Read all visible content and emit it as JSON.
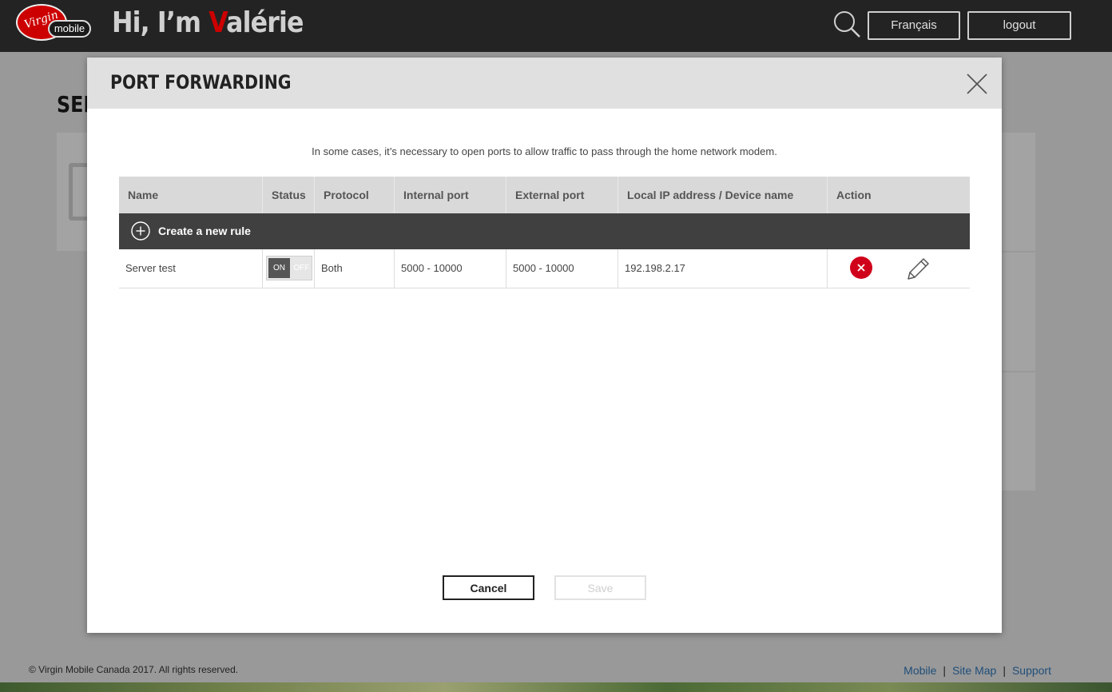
{
  "header": {
    "logo": {
      "brand": "Virgin",
      "sub": "mobile"
    },
    "greeting_prefix": "Hi, I’m ",
    "greeting_accent": "V",
    "greeting_rest": "alérie",
    "language_button": "Français",
    "logout_button": "logout",
    "accent_color": "#cc0000"
  },
  "background_page": {
    "title_fragment": "SER"
  },
  "modal": {
    "title": "PORT FORWARDING",
    "intro": "In some cases, it’s necessary to open ports to allow traffic to pass through the home network modem.",
    "columns": [
      "Name",
      "Status",
      "Protocol",
      "Internal port",
      "External port",
      "Local IP address / Device name",
      "Action"
    ],
    "create_rule_label": "Create a new rule",
    "rules": [
      {
        "name": "Server test",
        "status_on": "ON",
        "status_off": "OFF",
        "status": "on",
        "protocol": "Both",
        "internal_port": "5000 - 10000",
        "external_port": "5000 - 10000",
        "local_ip": "192.198.2.17"
      }
    ],
    "cancel_button": "Cancel",
    "save_button": "Save"
  },
  "footer": {
    "copyright": "© Virgin Mobile Canada 2017. All rights reserved.",
    "links": [
      "Mobile",
      "Site Map",
      "Support"
    ],
    "separator": "|"
  }
}
